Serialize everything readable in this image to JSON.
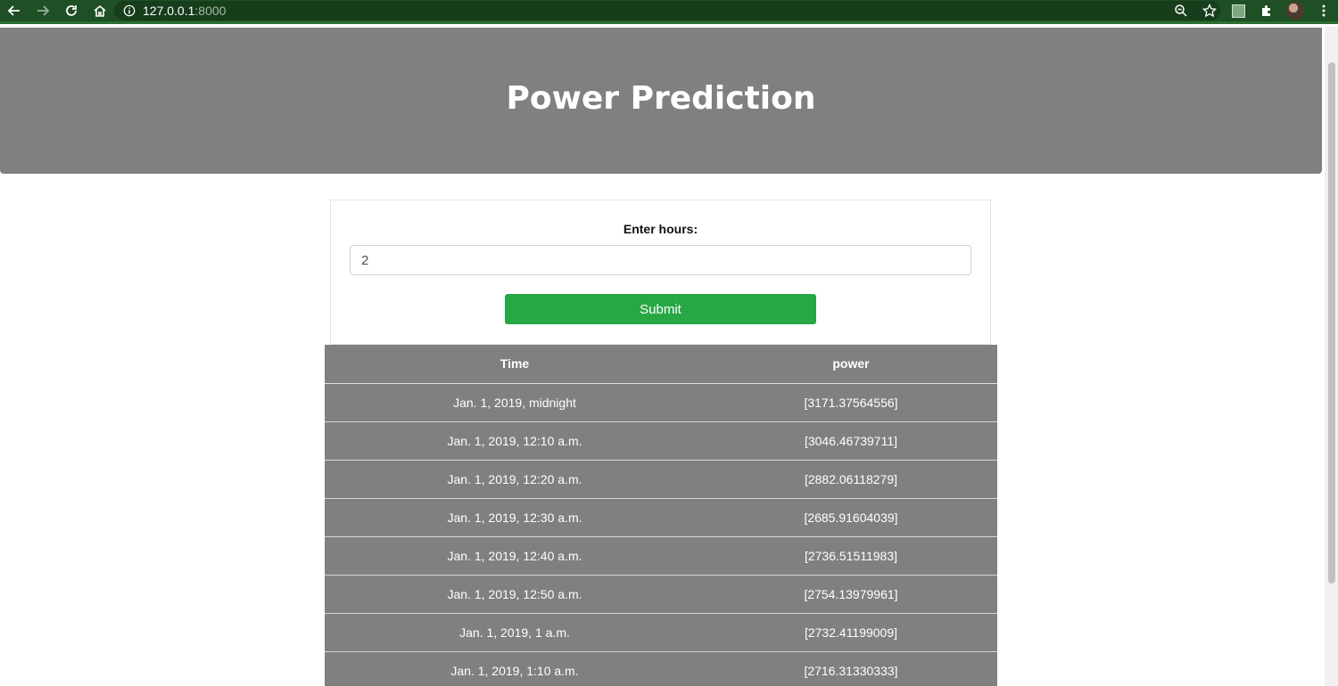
{
  "browser": {
    "url_host": "127.0.0.1",
    "url_port": ":8000",
    "theme_color": "#1f4f24"
  },
  "header": {
    "title": "Power Prediction",
    "background": "#808080"
  },
  "form": {
    "label": "Enter hours:",
    "input_value": "2",
    "submit_label": "Submit",
    "submit_color": "#28a745"
  },
  "table": {
    "columns": [
      "Time",
      "power"
    ],
    "rows": [
      [
        "Jan. 1, 2019, midnight",
        "[3171.37564556]"
      ],
      [
        "Jan. 1, 2019, 12:10 a.m.",
        "[3046.46739711]"
      ],
      [
        "Jan. 1, 2019, 12:20 a.m.",
        "[2882.06118279]"
      ],
      [
        "Jan. 1, 2019, 12:30 a.m.",
        "[2685.91604039]"
      ],
      [
        "Jan. 1, 2019, 12:40 a.m.",
        "[2736.51511983]"
      ],
      [
        "Jan. 1, 2019, 12:50 a.m.",
        "[2754.13979961]"
      ],
      [
        "Jan. 1, 2019, 1 a.m.",
        "[2732.41199009]"
      ],
      [
        "Jan. 1, 2019, 1:10 a.m.",
        "[2716.31330333]"
      ]
    ]
  }
}
